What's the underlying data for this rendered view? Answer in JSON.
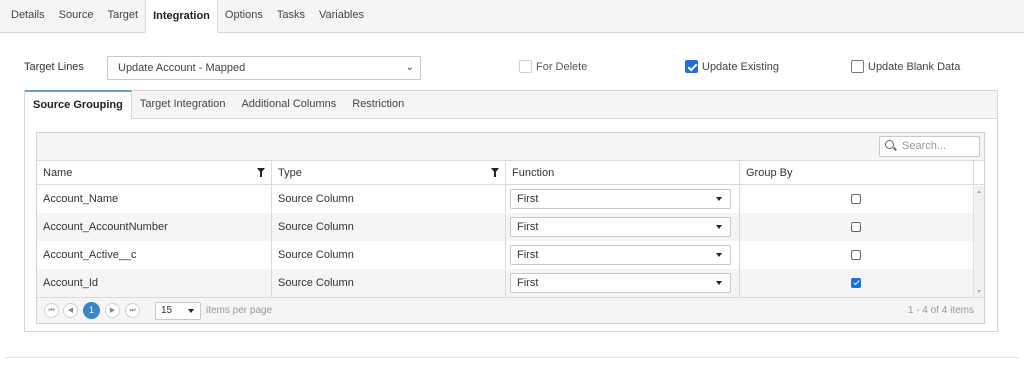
{
  "top_tabs": [
    "Details",
    "Source",
    "Target",
    "Integration",
    "Options",
    "Tasks",
    "Variables"
  ],
  "active_top_tab": "Integration",
  "target_lines": {
    "label": "Target Lines",
    "selected": "Update Account - Mapped",
    "caret": "⌄"
  },
  "options": {
    "for_delete": {
      "label": "For Delete",
      "checked": false,
      "disabled": true
    },
    "update_existing": {
      "label": "Update Existing",
      "checked": true
    },
    "update_blank_data": {
      "label": "Update Blank Data",
      "checked": false
    }
  },
  "inner_tabs": [
    "Source Grouping",
    "Target Integration",
    "Additional Columns",
    "Restriction"
  ],
  "active_inner_tab": "Source Grouping",
  "grid": {
    "search_placeholder": "Search...",
    "columns": [
      "Name",
      "Type",
      "Function",
      "Group By"
    ],
    "rows": [
      {
        "name": "Account_Name",
        "type": "Source Column",
        "function": "First",
        "group_by": false
      },
      {
        "name": "Account_AccountNumber",
        "type": "Source Column",
        "function": "First",
        "group_by": false
      },
      {
        "name": "Account_Active__c",
        "type": "Source Column",
        "function": "First",
        "group_by": false
      },
      {
        "name": "Account_Id",
        "type": "Source Column",
        "function": "First",
        "group_by": true
      }
    ]
  },
  "pager": {
    "first": "⏮",
    "prev": "◀",
    "current_page": "1",
    "next": "▶",
    "last": "⏭",
    "page_size": "15",
    "items_per_page": "items per page",
    "info": "1 - 4 of 4 items"
  },
  "colors": {
    "accent": "#1e6fd9",
    "pager_active": "#3a85c6",
    "tab_border": "#6aa0c7"
  }
}
